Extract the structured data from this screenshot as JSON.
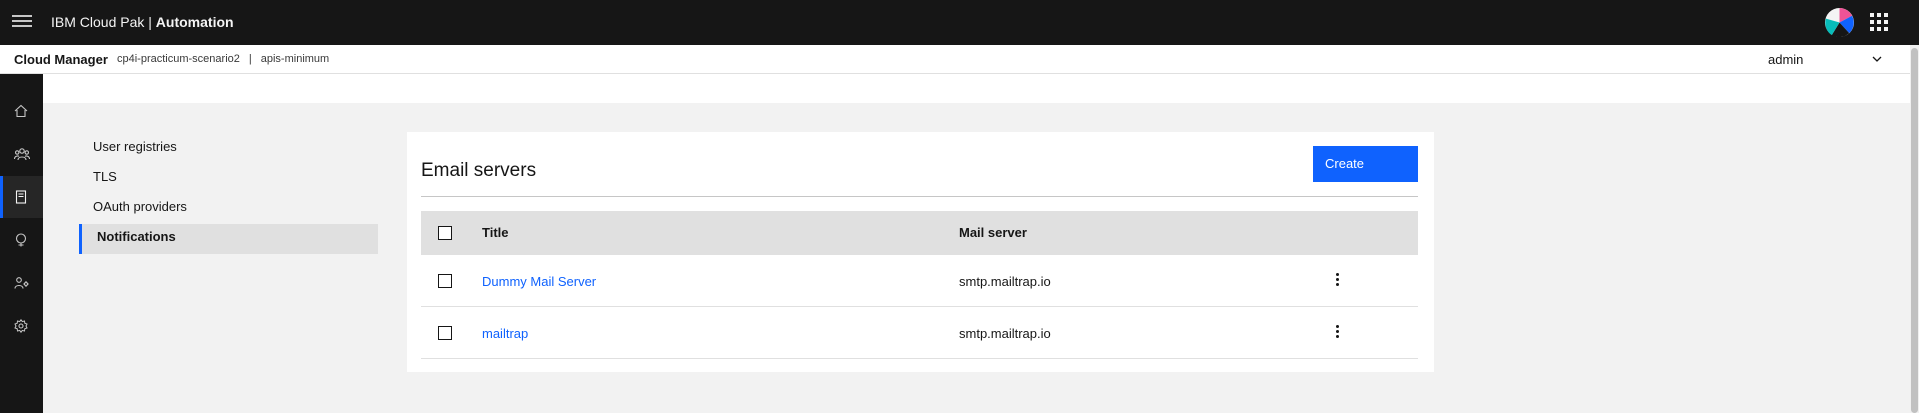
{
  "header": {
    "brand_prefix": "IBM Cloud Pak | ",
    "brand_strong": "Automation",
    "menu_icon": "hamburger-icon",
    "apps_icon": "app-switcher-icon"
  },
  "subheader": {
    "title": "Cloud Manager",
    "crumb1": "cp4i-practicum-scenario2",
    "separator": "|",
    "crumb2": "apis-minimum",
    "user": "admin"
  },
  "rail": {
    "items": [
      {
        "name": "home-icon"
      },
      {
        "name": "members-icon"
      },
      {
        "name": "resources-icon",
        "active": true
      },
      {
        "name": "topology-icon"
      },
      {
        "name": "user-management-icon"
      },
      {
        "name": "settings-icon"
      }
    ]
  },
  "secnav": {
    "items": [
      {
        "label": "User registries"
      },
      {
        "label": "TLS"
      },
      {
        "label": "OAuth providers"
      },
      {
        "label": "Notifications",
        "active": true
      }
    ]
  },
  "card": {
    "title": "Email servers",
    "create_label": "Create",
    "columns": {
      "title": "Title",
      "mail_server": "Mail server"
    },
    "rows": [
      {
        "title": "Dummy Mail Server",
        "mail_server": "smtp.mailtrap.io"
      },
      {
        "title": "mailtrap",
        "mail_server": "smtp.mailtrap.io"
      }
    ]
  },
  "colors": {
    "accent": "#0f62fe",
    "header_bg": "#161616"
  }
}
